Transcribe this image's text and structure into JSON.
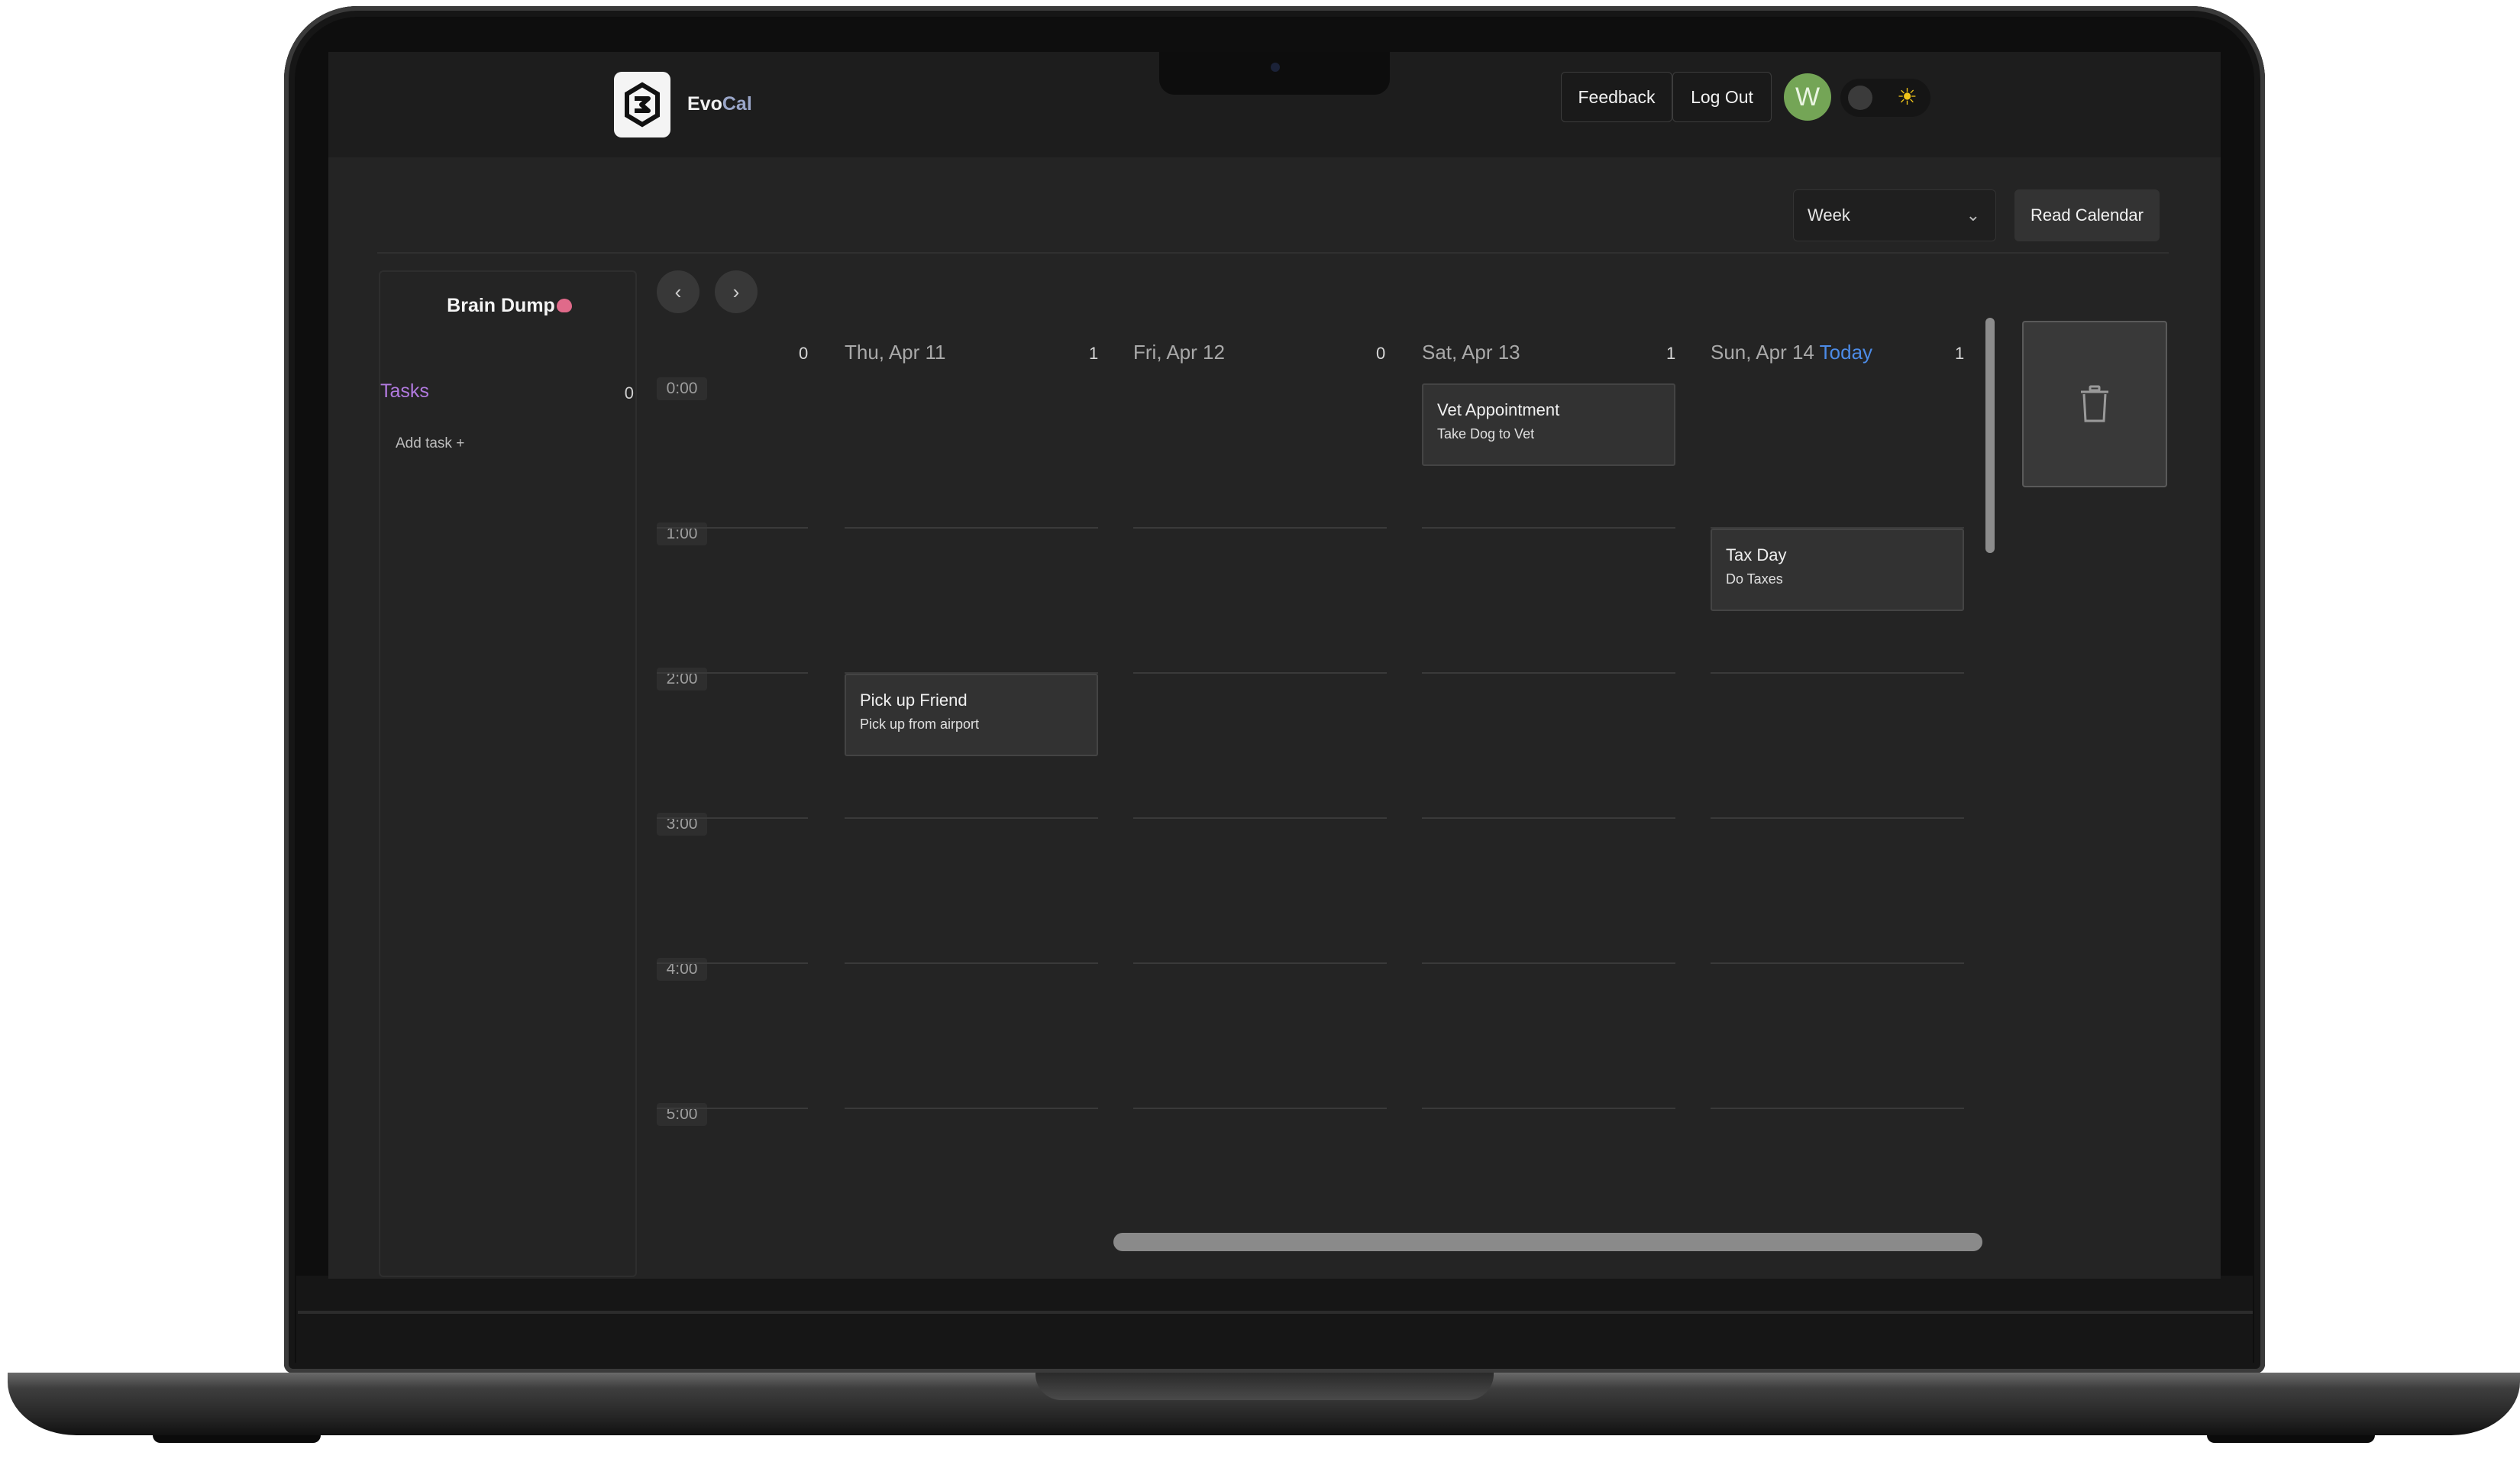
{
  "app": {
    "brand_main": "Evo",
    "brand_accent": "Cal"
  },
  "header": {
    "feedback_label": "Feedback",
    "logout_label": "Log Out",
    "avatar_initial": "W",
    "theme_icon": "sun-icon"
  },
  "toolbar": {
    "view_value": "Week",
    "read_calendar_label": "Read Calendar"
  },
  "sidebar": {
    "title": "Brain Dump",
    "title_icon": "brain-icon",
    "tasks_label": "Tasks",
    "tasks_count": "0",
    "add_task_label": "Add task +"
  },
  "calendar": {
    "prev_icon": "chevron-left-icon",
    "next_icon": "chevron-right-icon",
    "columns": [
      {
        "label": "",
        "count": "0"
      },
      {
        "label": "Thu, Apr 11",
        "count": "1"
      },
      {
        "label": "Fri, Apr 12",
        "count": "0"
      },
      {
        "label": "Sat, Apr 13",
        "count": "1"
      },
      {
        "label": "Sun, Apr 14",
        "today_label": "Today",
        "count": "1"
      }
    ],
    "hours": [
      "0:00",
      "1:00",
      "2:00",
      "3:00",
      "4:00",
      "5:00"
    ],
    "events": [
      {
        "title": "Vet Appointment",
        "desc": "Take Dog to Vet"
      },
      {
        "title": "Tax Day",
        "desc": "Do Taxes"
      },
      {
        "title": "Pick up Friend",
        "desc": "Pick up from airport"
      }
    ],
    "trash_icon": "trash-icon"
  },
  "colors": {
    "accent_tasks": "#b27ae0",
    "today": "#4c8be6",
    "avatar": "#74a556",
    "background": "#242424"
  }
}
